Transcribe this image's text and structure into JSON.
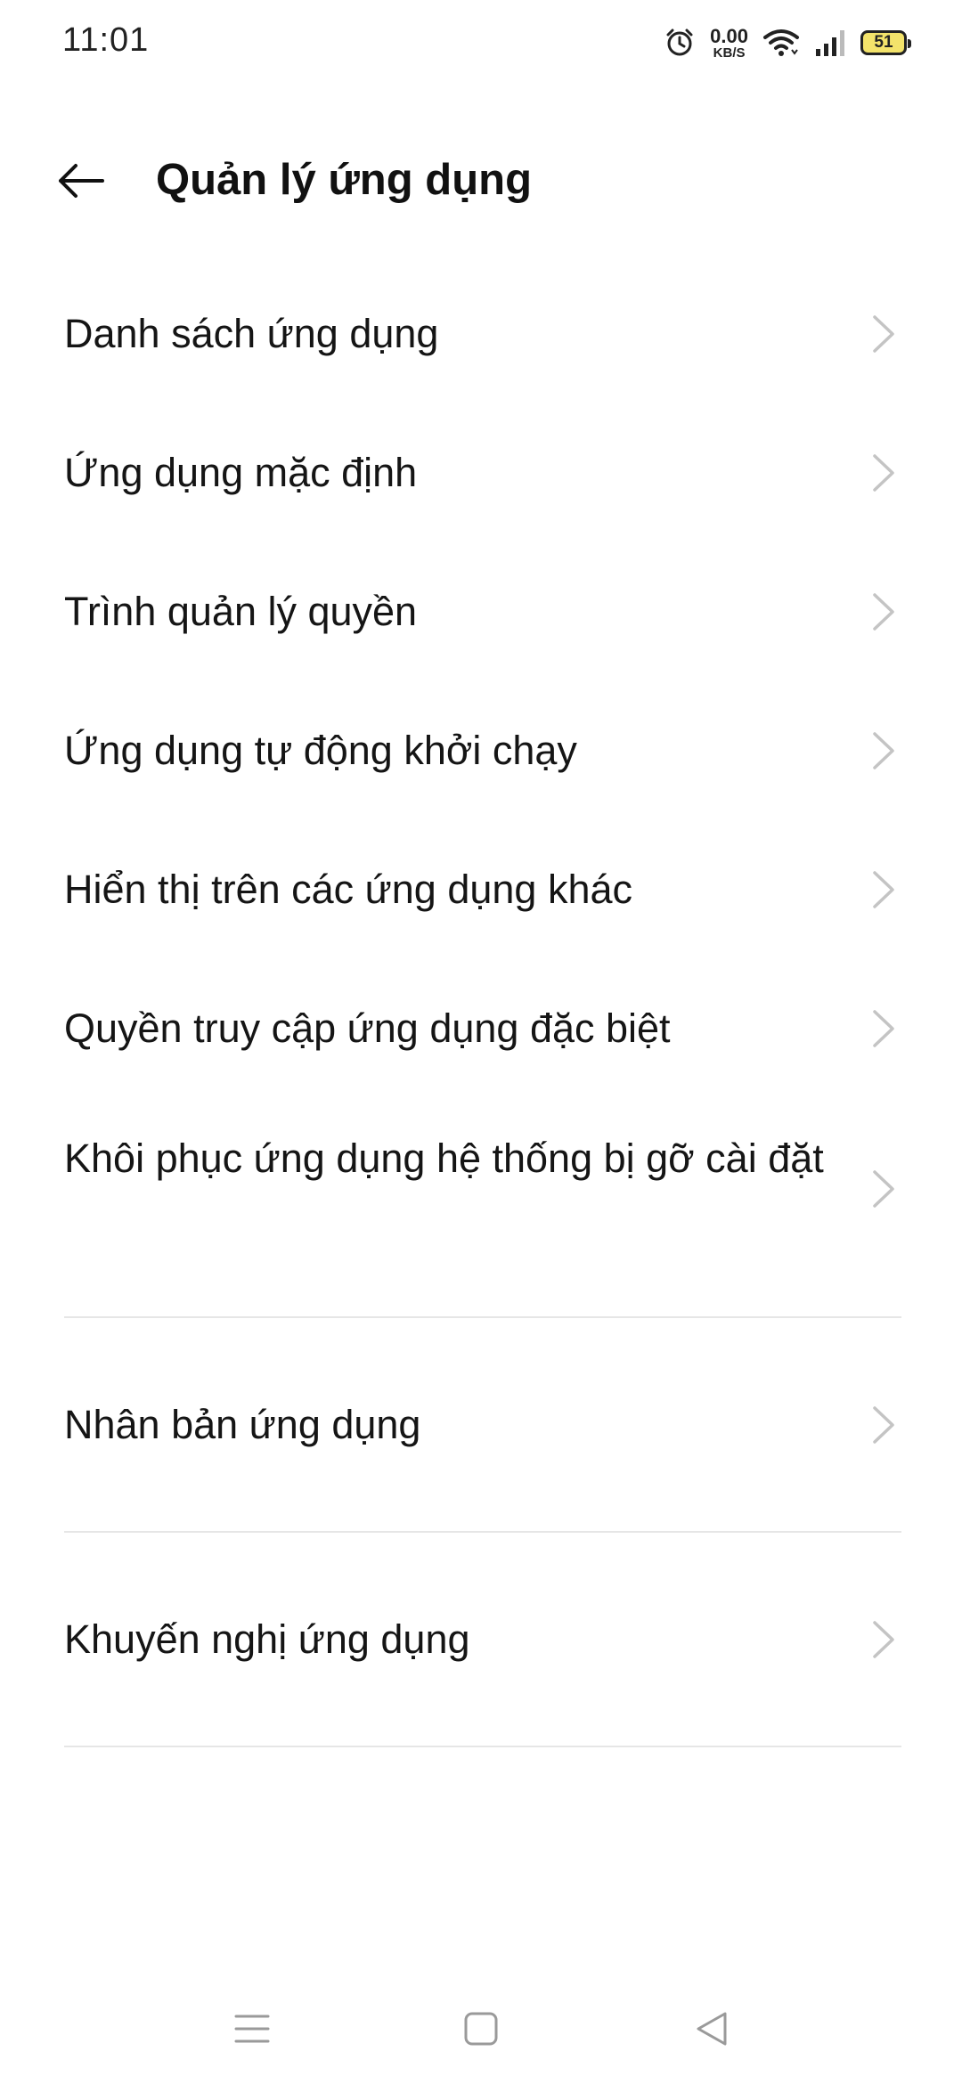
{
  "status_bar": {
    "time": "11:01",
    "net_speed_value": "0.00",
    "net_speed_unit": "KB/S",
    "battery": "51",
    "icons": [
      "alarm-icon",
      "wifi-icon",
      "signal-icon",
      "battery-icon"
    ]
  },
  "header": {
    "title": "Quản lý ứng dụng",
    "back_icon": "arrow-left-icon"
  },
  "menu": {
    "items": [
      {
        "label": "Danh sách ứng dụng"
      },
      {
        "label": "Ứng dụng mặc định"
      },
      {
        "label": "Trình quản lý quyền"
      },
      {
        "label": "Ứng dụng tự động khởi chạy"
      },
      {
        "label": "Hiển thị trên các ứng dụng khác"
      },
      {
        "label": "Quyền truy cập ứng dụng đặc biệt"
      },
      {
        "label": "Khôi phục ứng dụng hệ thống bị gỡ cài đặt"
      },
      {
        "label": "Nhân bản ứng dụng"
      },
      {
        "label": "Khuyến nghị ứng dụng"
      }
    ]
  },
  "nav_bar": {
    "icons": [
      "menu-icon",
      "home-icon",
      "back-icon"
    ]
  },
  "colors": {
    "text": "#151515",
    "chevron": "#c4c4c4",
    "divider": "#e6e6e6",
    "battery_fill": "#f3e36b"
  }
}
